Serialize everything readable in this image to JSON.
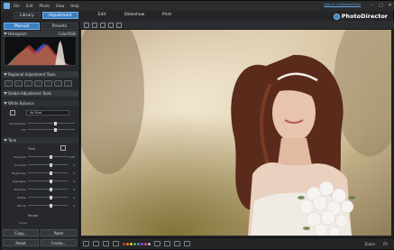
{
  "menu": [
    "File",
    "Edit",
    "Photo",
    "View",
    "Help"
  ],
  "top_tabs": [
    {
      "label": "Library",
      "active": false
    },
    {
      "label": "Adjustment",
      "active": true
    }
  ],
  "sign_in": "Sign in to DirectorZone",
  "subtabs": [
    {
      "label": "Manual",
      "active": true
    },
    {
      "label": "Presets",
      "active": false
    }
  ],
  "modes": [
    {
      "label": "Edit",
      "active": false
    },
    {
      "label": "Slideshow",
      "active": false
    },
    {
      "label": "Print",
      "active": false
    }
  ],
  "brand": "PhotoDirector",
  "panel": {
    "histogram": "Histogram",
    "color_mode": "Color",
    "rgb": "RGB",
    "regional": "Regional Adjustment Tools",
    "global": "Global Adjustment Tools",
    "white_balance": "White Balance",
    "wb_preset": "As Shot",
    "wb_sliders": [
      {
        "label": "Temperature",
        "pos": 0.55
      },
      {
        "label": "Tint",
        "pos": 0.55
      }
    ],
    "tone": "Tone",
    "tone_label": "Tone",
    "tone_sliders": [
      {
        "label": "Exposure",
        "value": "0.00",
        "pos": 0.55
      },
      {
        "label": "Contrast",
        "value": "0",
        "pos": 0.55
      },
      {
        "label": "Brightness",
        "value": "0",
        "pos": 0.55
      },
      {
        "label": "Highlights",
        "value": "0",
        "pos": 0.55
      },
      {
        "label": "Shadows",
        "value": "0",
        "pos": 0.55
      },
      {
        "label": "Whites",
        "value": "0",
        "pos": 0.55
      },
      {
        "label": "Blacks",
        "value": "0",
        "pos": 0.55
      }
    ],
    "range": "Range",
    "curve_label": "Curve",
    "copy": "Copy...",
    "paste": "Paste",
    "reset": "Reset",
    "create": "Create..."
  },
  "status": {
    "zoom_label": "Zoom",
    "zoom_value": "Fit"
  },
  "colors": {
    "accent": "#3b80c2",
    "swatches": [
      "#d03a3a",
      "#e08a2a",
      "#e6d33a",
      "#4fb44f",
      "#3a8fd6",
      "#8a4fd0",
      "#d04fa6",
      "#c0c0c0"
    ]
  }
}
